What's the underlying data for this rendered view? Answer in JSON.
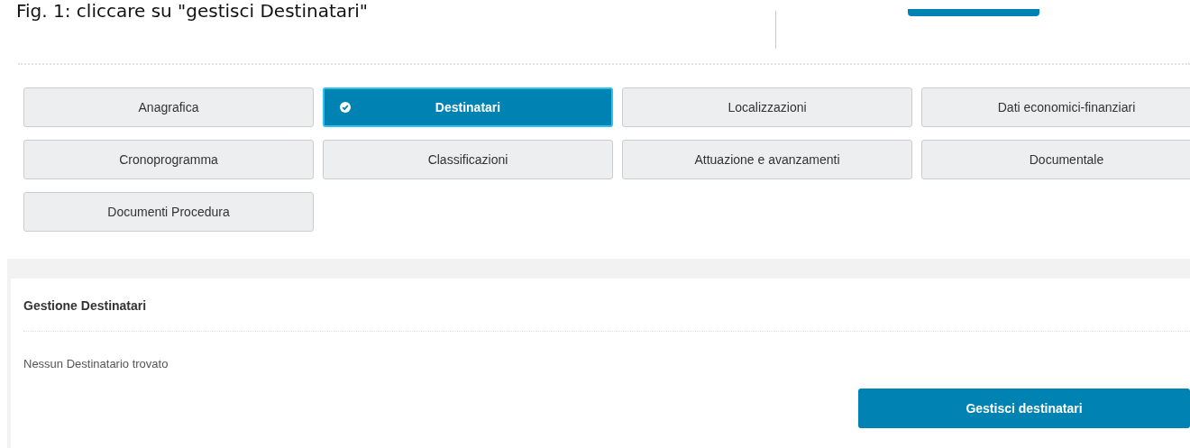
{
  "caption": "Fig. 1: cliccare su \"gestisci Destinatari\"",
  "tabs": [
    {
      "label": "Anagrafica",
      "selected": false
    },
    {
      "label": "Destinatari",
      "selected": true
    },
    {
      "label": "Localizzazioni",
      "selected": false
    },
    {
      "label": "Dati economici-finanziari",
      "selected": false
    },
    {
      "label": "Cronoprogramma",
      "selected": false
    },
    {
      "label": "Classificazioni",
      "selected": false
    },
    {
      "label": "Attuazione e avanzamenti",
      "selected": false
    },
    {
      "label": "Documentale",
      "selected": false
    },
    {
      "label": "Documenti Procedura",
      "selected": false
    }
  ],
  "panel": {
    "title": "Gestione Destinatari",
    "message": "Nessun Destinatario trovato",
    "button": "Gestisci destinatari"
  }
}
